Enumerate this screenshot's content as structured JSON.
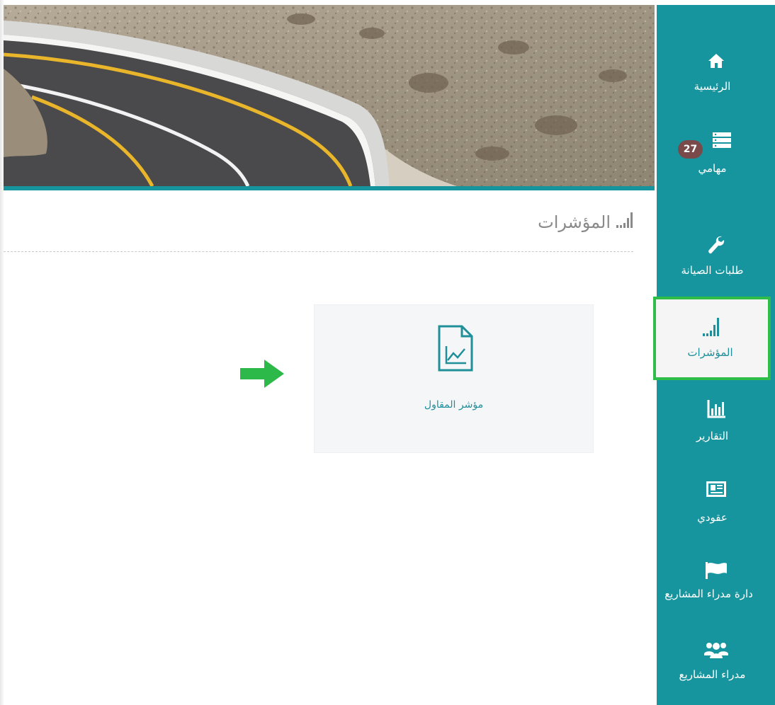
{
  "header": {
    "title": "المؤشرات"
  },
  "content": {
    "cards": [
      {
        "label": "مؤشر المقاول",
        "icon": "chart-document-icon"
      }
    ]
  },
  "sidebar": {
    "items": [
      {
        "label": "الرئيسية",
        "icon": "home-icon"
      },
      {
        "label": "مهامي",
        "icon": "tasks-icon",
        "badge": "27"
      },
      {
        "label": "طلبات الصيانة",
        "icon": "wrench-icon"
      },
      {
        "label": "المؤشرات",
        "icon": "signal-bars-icon",
        "active": true
      },
      {
        "label": "التقارير",
        "icon": "bar-chart-icon"
      },
      {
        "label": "عقودي",
        "icon": "newspaper-icon"
      },
      {
        "label": "دارة مدراء المشاريع",
        "icon": "flag-icon"
      },
      {
        "label": "مدراء المشاريع",
        "icon": "users-icon"
      }
    ]
  },
  "colors": {
    "accent": "#17959f",
    "highlight": "#2fbd4a",
    "badge": "#7a4a4a",
    "arrow": "#2db84a"
  }
}
